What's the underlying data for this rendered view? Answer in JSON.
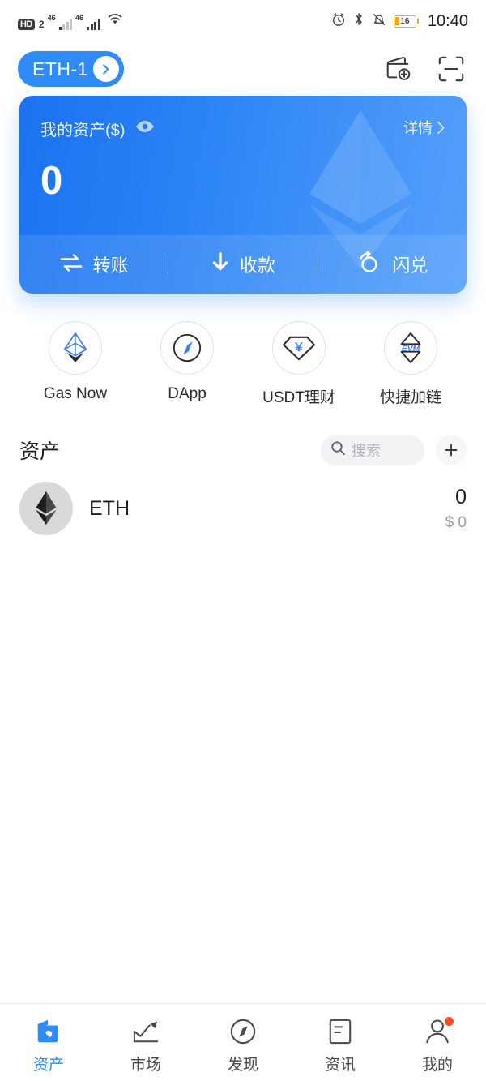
{
  "statusbar": {
    "hd_badge": "HD",
    "sim_badge": "2",
    "net1": "46",
    "net2": "46",
    "battery_percent": "16",
    "time": "10:40"
  },
  "header": {
    "wallet_name": "ETH-1",
    "add_wallet_icon": "add-wallet-icon",
    "scan_icon": "scan-icon"
  },
  "balance_card": {
    "label": "我的资产($)",
    "eye_icon": "eye-icon",
    "detail_label": "详情",
    "amount": "0",
    "actions": [
      {
        "label": "转账",
        "icon": "transfer-icon"
      },
      {
        "label": "收款",
        "icon": "receive-icon"
      },
      {
        "label": "闪兑",
        "icon": "swap-icon"
      }
    ]
  },
  "quick_entries": [
    {
      "label": "Gas Now",
      "icon": "eth-outline-icon"
    },
    {
      "label": "DApp",
      "icon": "compass-icon"
    },
    {
      "label": "USDT理财",
      "icon": "gem-yuan-icon"
    },
    {
      "label": "快捷加链",
      "icon": "evm-chain-icon"
    }
  ],
  "assets": {
    "title": "资产",
    "search_placeholder": "搜索",
    "search_value": "",
    "add_label": "+",
    "rows": [
      {
        "symbol": "ETH",
        "amount": "0",
        "fiat": "$ 0",
        "logo": "eth-coin-icon"
      }
    ]
  },
  "bottom_nav": [
    {
      "label": "资产",
      "icon": "wallet-icon",
      "active": true
    },
    {
      "label": "市场",
      "icon": "chart-icon",
      "active": false
    },
    {
      "label": "发现",
      "icon": "compass-icon",
      "active": false
    },
    {
      "label": "资讯",
      "icon": "news-icon",
      "active": false
    },
    {
      "label": "我的",
      "icon": "person-icon",
      "active": false,
      "badge": true
    }
  ],
  "colors": {
    "accent": "#2e8bf7",
    "card_start": "#1a72f0",
    "card_end": "#55a0fb",
    "badge": "#f4511e",
    "battery": "#f5a623"
  }
}
